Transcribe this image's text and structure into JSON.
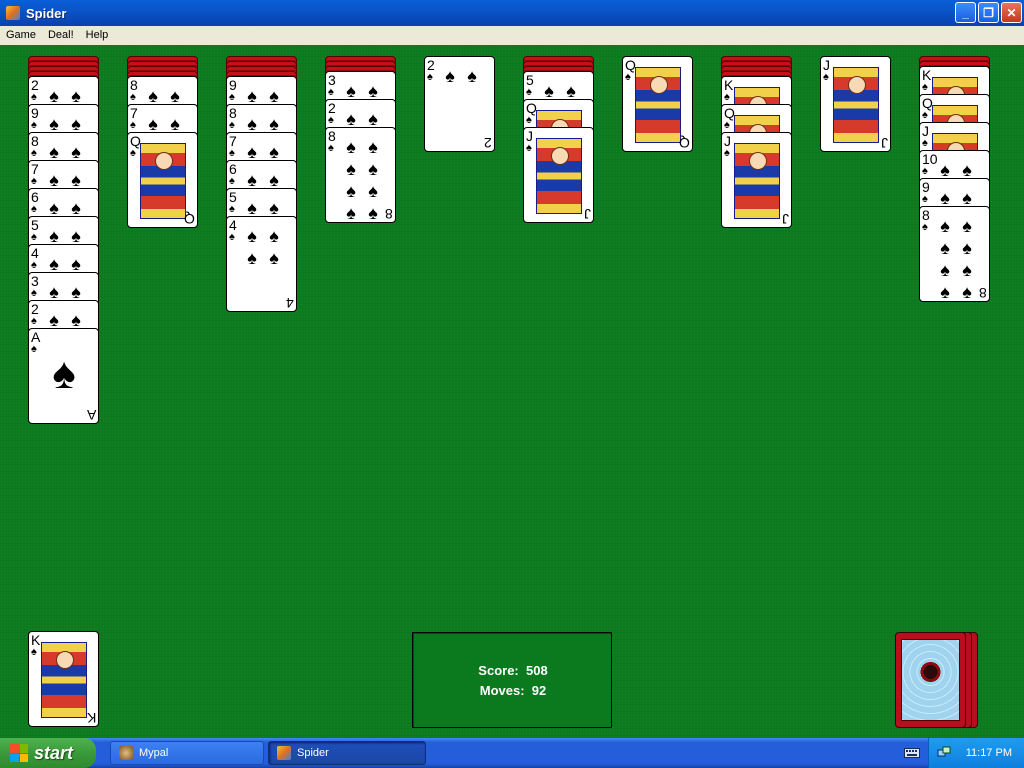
{
  "window": {
    "title": "Spider",
    "buttons": {
      "minimize": "_",
      "maximize": "❐",
      "close": "✕"
    }
  },
  "menu": [
    "Game",
    "Deal!",
    "Help"
  ],
  "tableau": [
    {
      "down": 4,
      "up": [
        "2",
        "9",
        "8",
        "7",
        "6",
        "5",
        "4",
        "3",
        "2",
        "A"
      ]
    },
    {
      "down": 4,
      "up": [
        "8",
        "7",
        "Q"
      ]
    },
    {
      "down": 4,
      "up": [
        "9",
        "8",
        "7",
        "6",
        "5",
        "4"
      ]
    },
    {
      "down": 3,
      "up": [
        "3",
        "2",
        "8"
      ]
    },
    {
      "down": 0,
      "up": [
        "2"
      ]
    },
    {
      "down": 3,
      "up": [
        "5",
        "Q",
        "J"
      ]
    },
    {
      "down": 0,
      "up": [
        "Q"
      ]
    },
    {
      "down": 4,
      "up": [
        "K",
        "Q",
        "J"
      ]
    },
    {
      "down": 0,
      "up": [
        "J"
      ]
    },
    {
      "down": 2,
      "up": [
        "K",
        "Q",
        "J",
        "10",
        "9",
        "8"
      ]
    }
  ],
  "suit": "♠",
  "completed": {
    "top_rank": "K"
  },
  "stock": {
    "piles": 3
  },
  "status": {
    "score_label": "Score:",
    "score": "508",
    "moves_label": "Moves:",
    "moves": "92"
  },
  "taskbar": {
    "start": "start",
    "tasks": [
      {
        "label": "Mypal",
        "active": false
      },
      {
        "label": "Spider",
        "active": true
      }
    ],
    "clock": "11:17 PM"
  },
  "colors": {
    "felt": "#0b7a1e",
    "card_back": "#c80f18",
    "titlebar": "#0b54c9",
    "taskbar": "#245edb"
  }
}
